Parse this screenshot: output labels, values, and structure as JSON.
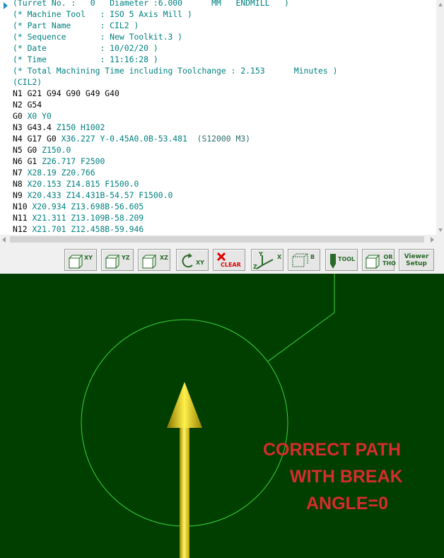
{
  "editor": {
    "lines": [
      {
        "prefix": "(Turret No. :   0   Diameter :6.000      MM   ENDMILL   )",
        "rest": "",
        "tail": "",
        "style": "cmt"
      },
      {
        "prefix": "(* Machine Tool   : ISO 5 Axis Mill )",
        "rest": "",
        "tail": "",
        "style": "cmt"
      },
      {
        "prefix": "(* Part Name      : CIL2 )",
        "rest": "",
        "tail": "",
        "style": "cmt"
      },
      {
        "prefix": "(* Sequence       : New Toolkit.3 )",
        "rest": "",
        "tail": "",
        "style": "cmt"
      },
      {
        "prefix": "(* Date           : 10/02/20 )",
        "rest": "",
        "tail": "",
        "style": "cmt"
      },
      {
        "prefix": "(* Time           : 11:16:28 )",
        "rest": "",
        "tail": "",
        "style": "cmt"
      },
      {
        "prefix": "(* Total Machining Time including Toolchange : 2.153      Minutes )",
        "rest": "",
        "tail": "",
        "style": "cmt"
      },
      {
        "prefix": "(CIL2)",
        "rest": "",
        "tail": "",
        "style": "cmt"
      },
      {
        "prefix": "N1 G21 G94 G90 G49 G40",
        "rest": "",
        "tail": "",
        "style": "blk"
      },
      {
        "prefix": "N2 G54",
        "rest": "",
        "tail": "",
        "style": "blk"
      },
      {
        "prefix": "G0 ",
        "rest": "X0 Y0",
        "tail": "",
        "style": "blk"
      },
      {
        "prefix": "N3 G43.4 ",
        "rest": "Z150 H1002",
        "tail": "",
        "style": "blk"
      },
      {
        "prefix": "N4 G17 G0 ",
        "rest": "X36.227 Y-0.45A0.0B-53.481",
        "tail": "  (S12000 M3)",
        "style": "blk"
      },
      {
        "prefix": "N5 G0 ",
        "rest": "Z150.0",
        "tail": "",
        "style": "blk"
      },
      {
        "prefix": "N6 G1 ",
        "rest": "Z26.717 F2500",
        "tail": "",
        "style": "blk"
      },
      {
        "prefix": "N7 ",
        "rest": "X28.19 Z20.766",
        "tail": "",
        "style": "blk"
      },
      {
        "prefix": "N8 ",
        "rest": "X20.153 Z14.815 F1500.0",
        "tail": "",
        "style": "blk"
      },
      {
        "prefix": "N9 ",
        "rest": "X20.433 Z14.431B-54.57 F1500.0",
        "tail": "",
        "style": "blk"
      },
      {
        "prefix": "N10 ",
        "rest": "X20.934 Z13.698B-56.605",
        "tail": "",
        "style": "blk"
      },
      {
        "prefix": "N11 ",
        "rest": "X21.311 Z13.109B-58.209",
        "tail": "",
        "style": "blk"
      },
      {
        "prefix": "N12 ",
        "rest": "X21.701 Z12.458B-59.946",
        "tail": "",
        "style": "blk"
      }
    ]
  },
  "toolbar": {
    "buttons": [
      {
        "name": "view-xy-button",
        "label": "XY",
        "icon": "cube-icon"
      },
      {
        "name": "view-yz-button",
        "label": "YZ",
        "icon": "cube-icon"
      },
      {
        "name": "view-xz-button",
        "label": "XZ",
        "icon": "cube-icon"
      },
      {
        "name": "rotate-xy-button",
        "label": "XY",
        "icon": "rotate-icon"
      },
      {
        "name": "clear-button",
        "label": "CLEAR",
        "icon": "red-x-icon"
      },
      {
        "name": "axes-button",
        "label": "Y X Z",
        "icon": "axes-icon"
      },
      {
        "name": "bounding-box-button",
        "label": "B",
        "icon": "box-icon"
      },
      {
        "name": "tool-button",
        "label": "TOOL",
        "icon": "tool-icon"
      },
      {
        "name": "ortho-button",
        "label": "OR THO",
        "icon": "cube-icon"
      },
      {
        "name": "viewer-setup-button",
        "label": "Viewer Setup",
        "icon": ""
      }
    ],
    "clear_color": "#e00000",
    "accent_green": "#2a6b2a"
  },
  "viewport": {
    "background": "#003f00",
    "circle_color": "#3bd13b",
    "tool_color": "#f0e020",
    "caption": [
      "CORRECT PATH",
      "WITH BREAK",
      "ANGLE=0"
    ],
    "caption_color": "#d72c2c"
  }
}
